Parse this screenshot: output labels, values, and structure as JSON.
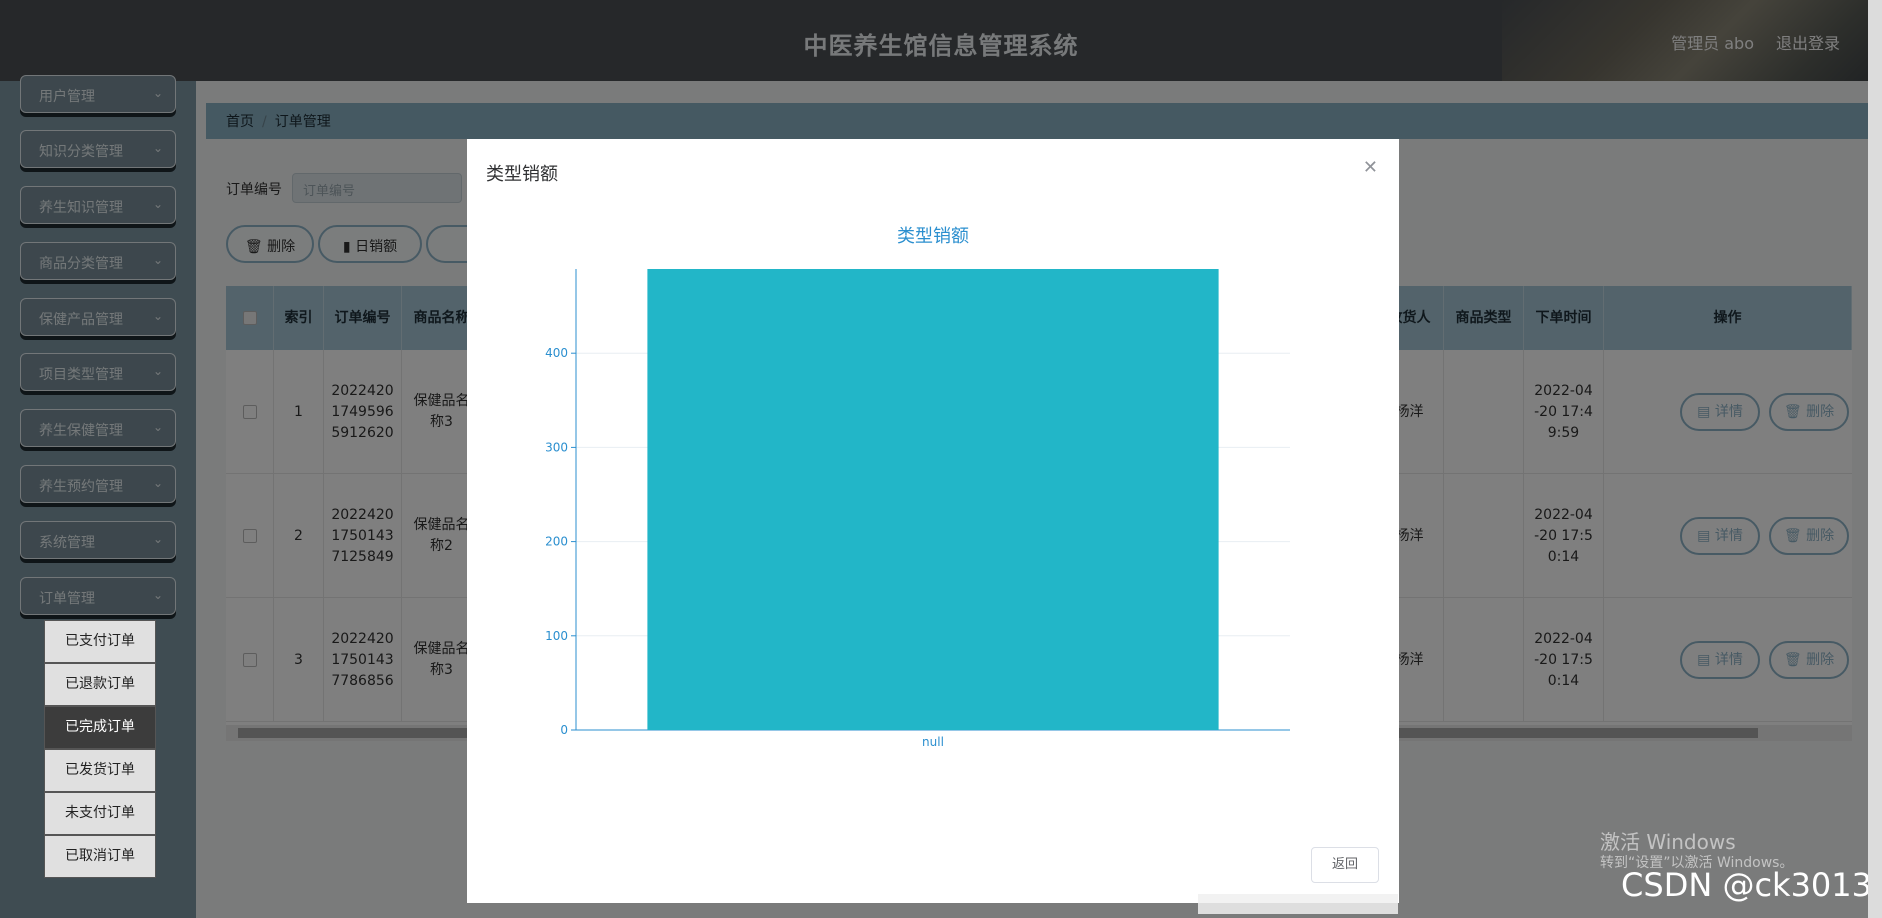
{
  "header": {
    "title": "中医养生馆信息管理系统",
    "user": "管理员 abo",
    "logout": "退出登录"
  },
  "sidebar": {
    "items": [
      "用户管理",
      "知识分类管理",
      "养生知识管理",
      "商品分类管理",
      "保健产品管理",
      "项目类型管理",
      "养生保健管理",
      "养生预约管理",
      "系统管理",
      "订单管理"
    ],
    "subitems": [
      "已支付订单",
      "已退款订单",
      "已完成订单",
      "已发货订单",
      "未支付订单",
      "已取消订单"
    ],
    "active_sub": "已完成订单"
  },
  "breadcrumb": {
    "home": "首页",
    "sep": "/",
    "current": "订单管理"
  },
  "search": {
    "label": "订单编号",
    "placeholder": "订单编号"
  },
  "actions": {
    "delete": "删除",
    "daily": "日销额"
  },
  "table": {
    "headers": {
      "select": "",
      "index": "索引",
      "order_no": "订单编号",
      "product": "商品名称",
      "receiver": "收货人",
      "type": "商品类型",
      "time": "下单时间",
      "ops": "操作"
    },
    "rows": [
      {
        "index": "1",
        "order_no": "2022420 1749596 5912620",
        "product": "保健品名 称3",
        "receiver": "杨洋",
        "time": "2022-04 -20 17:4 9:59"
      },
      {
        "index": "2",
        "order_no": "2022420 1750143 7125849",
        "product": "保健品名 称2",
        "receiver": "杨洋",
        "time": "2022-04 -20 17:5 0:14"
      },
      {
        "index": "3",
        "order_no": "2022420 1750143 7786856",
        "product": "保健品名 称3",
        "receiver": "杨洋",
        "time": "2022-04 -20 17:5 0:14"
      }
    ],
    "detail_label": "详情",
    "delete_label": "删除"
  },
  "dialog": {
    "title": "类型销额",
    "close": "✕",
    "back": "返回",
    "chart_title": "类型销额"
  },
  "chart_data": {
    "type": "bar",
    "title": "类型销额",
    "categories": [
      "null"
    ],
    "values": [
      500
    ],
    "ylim": [
      0,
      500
    ],
    "yticks": [
      0,
      100,
      200,
      300,
      400,
      500
    ],
    "bar_color": "#22b6c8",
    "axis_color": "#2b8fcf"
  },
  "overlay_text": {
    "windows_title": "激活 Windows",
    "windows_sub": "转到“设置”以激活 Windows。",
    "csdn": "CSDN @ck3013"
  }
}
